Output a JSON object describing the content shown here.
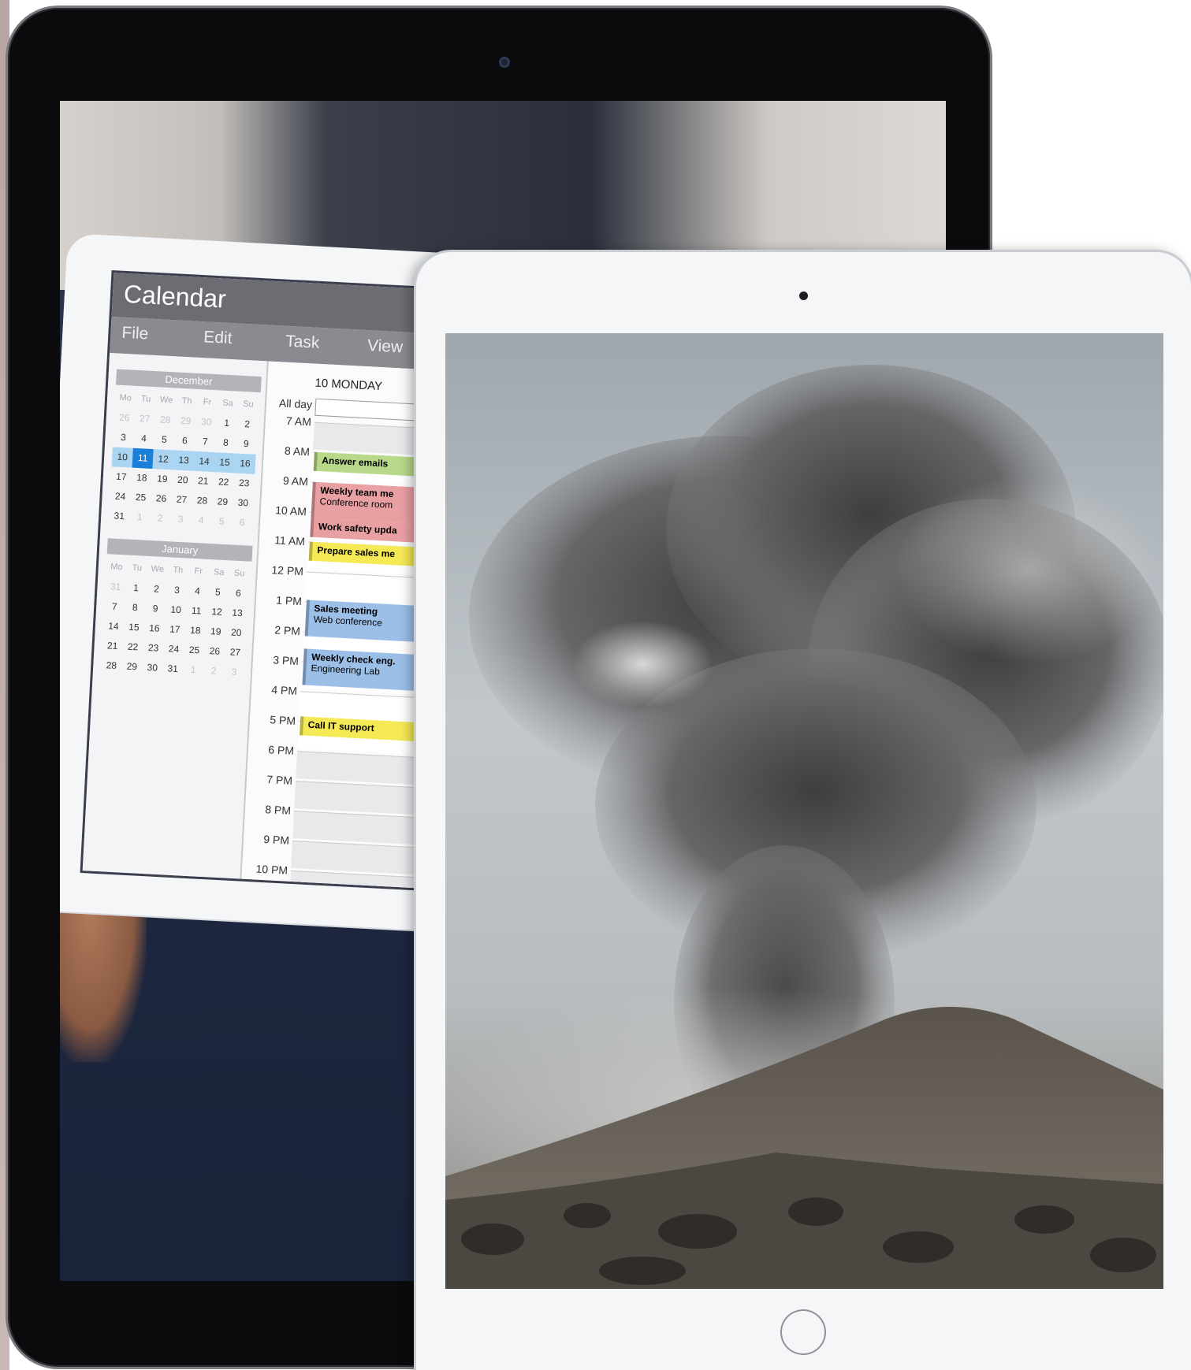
{
  "calendar": {
    "title": "Calendar",
    "menus": [
      "File",
      "Edit",
      "Task",
      "View"
    ],
    "december": {
      "name": "December",
      "weekdays": [
        "Mo",
        "Tu",
        "We",
        "Th",
        "Fr",
        "Sa",
        "Su"
      ],
      "weeks": [
        [
          "26",
          "27",
          "28",
          "29",
          "30",
          "1",
          "2"
        ],
        [
          "3",
          "4",
          "5",
          "6",
          "7",
          "8",
          "9"
        ],
        [
          "10",
          "11",
          "12",
          "13",
          "14",
          "15",
          "16"
        ],
        [
          "17",
          "18",
          "19",
          "20",
          "21",
          "22",
          "23"
        ],
        [
          "24",
          "25",
          "26",
          "27",
          "28",
          "29",
          "30"
        ],
        [
          "31",
          "1",
          "2",
          "3",
          "4",
          "5",
          "6"
        ]
      ]
    },
    "january": {
      "name": "January",
      "weekdays": [
        "Mo",
        "Tu",
        "We",
        "Th",
        "Fr",
        "Sa",
        "Su"
      ],
      "weeks": [
        [
          "31",
          "1",
          "2",
          "3",
          "4",
          "5",
          "6"
        ],
        [
          "7",
          "8",
          "9",
          "10",
          "11",
          "12",
          "13"
        ],
        [
          "14",
          "15",
          "16",
          "17",
          "18",
          "19",
          "20"
        ],
        [
          "21",
          "22",
          "23",
          "24",
          "25",
          "26",
          "27"
        ],
        [
          "28",
          "29",
          "30",
          "31",
          "1",
          "2",
          "3"
        ]
      ]
    },
    "day_view": {
      "date_label": "10   MONDAY",
      "all_day_label": "All day",
      "hours": [
        "7 AM",
        "8 AM",
        "9 AM",
        "10 AM",
        "11 AM",
        "12 PM",
        "1 PM",
        "2 PM",
        "3 PM",
        "4 PM",
        "5 PM",
        "6 PM",
        "7 PM",
        "8 PM",
        "9 PM",
        "10 PM"
      ],
      "events": [
        {
          "title": "Answer emails",
          "detail": "",
          "color": "green"
        },
        {
          "title": "Weekly team me",
          "detail": "Conference room",
          "color": "red"
        },
        {
          "title": "Work safety upda",
          "detail": "",
          "color": "red"
        },
        {
          "title": "Prepare sales me",
          "detail": "",
          "color": "yellow"
        },
        {
          "title": "Sales meeting",
          "detail": "Web conference",
          "color": "blue"
        },
        {
          "title": "Weekly check eng.",
          "detail": "Engineering Lab",
          "color": "blue"
        },
        {
          "title": "Call IT support",
          "detail": "",
          "color": "yellow"
        }
      ]
    }
  },
  "photo": {
    "subject": "volcanic eruption ash cloud"
  }
}
